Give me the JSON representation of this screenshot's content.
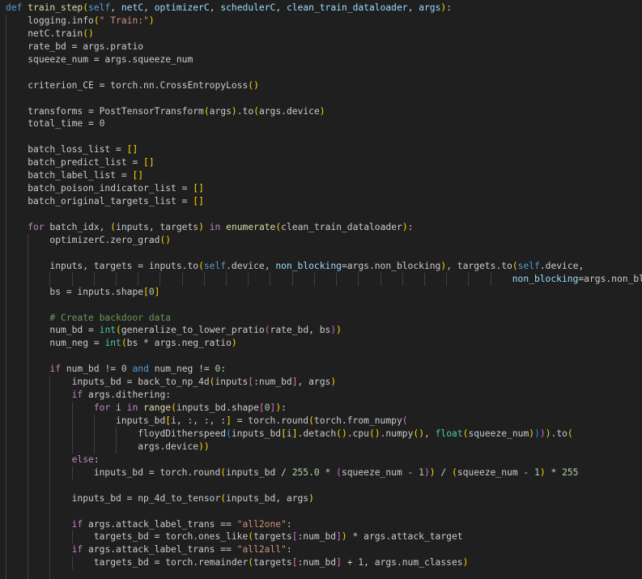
{
  "editor": {
    "language": "python",
    "colors": {
      "background": "#1f1f1f",
      "plain": "#cccccc",
      "keyword": "#569cd6",
      "control": "#c586c0",
      "function": "#dcdcaa",
      "string": "#ce9178",
      "number": "#b5cea8",
      "comment": "#6a9955",
      "class": "#4ec9b0",
      "bracket_1": "#ffd700",
      "bracket_2": "#da70d6",
      "bracket_3": "#179fff",
      "parameter": "#9cdcfe",
      "indent_guide": "#404040"
    },
    "lines": [
      {
        "indent": 0,
        "tokens": [
          [
            "kw",
            "def"
          ],
          [
            "pl",
            " "
          ],
          [
            "fn",
            "train_step"
          ],
          [
            "p1",
            "("
          ],
          [
            "self",
            "self"
          ],
          [
            "pl",
            ", "
          ],
          [
            "param",
            "netC"
          ],
          [
            "pl",
            ", "
          ],
          [
            "param",
            "optimizerC"
          ],
          [
            "pl",
            ", "
          ],
          [
            "param",
            "schedulerC"
          ],
          [
            "pl",
            ", "
          ],
          [
            "param",
            "clean_train_dataloader"
          ],
          [
            "pl",
            ", "
          ],
          [
            "param",
            "args"
          ],
          [
            "p1",
            ")"
          ],
          [
            "pl",
            ":"
          ]
        ]
      },
      {
        "indent": 1,
        "tokens": [
          [
            "pl",
            "logging.info"
          ],
          [
            "p1",
            "("
          ],
          [
            "str",
            "\" Train:\""
          ],
          [
            "p1",
            ")"
          ]
        ]
      },
      {
        "indent": 1,
        "tokens": [
          [
            "pl",
            "netC.train"
          ],
          [
            "p1",
            "()"
          ]
        ]
      },
      {
        "indent": 1,
        "tokens": [
          [
            "pl",
            "rate_bd = args.pratio"
          ]
        ]
      },
      {
        "indent": 1,
        "tokens": [
          [
            "pl",
            "squeeze_num = args.squeeze_num"
          ]
        ]
      },
      {
        "indent": 1,
        "tokens": []
      },
      {
        "indent": 1,
        "tokens": [
          [
            "pl",
            "criterion_CE = torch.nn.CrossEntropyLoss"
          ],
          [
            "p1",
            "()"
          ]
        ]
      },
      {
        "indent": 1,
        "tokens": []
      },
      {
        "indent": 1,
        "tokens": [
          [
            "pl",
            "transforms = PostTensorTransform"
          ],
          [
            "p1",
            "("
          ],
          [
            "pl",
            "args"
          ],
          [
            "p1",
            ")"
          ],
          [
            "pl",
            ".to"
          ],
          [
            "p1",
            "("
          ],
          [
            "pl",
            "args.device"
          ],
          [
            "p1",
            ")"
          ]
        ]
      },
      {
        "indent": 1,
        "tokens": [
          [
            "pl",
            "total_time = "
          ],
          [
            "num",
            "0"
          ]
        ]
      },
      {
        "indent": 1,
        "tokens": []
      },
      {
        "indent": 1,
        "tokens": [
          [
            "pl",
            "batch_loss_list = "
          ],
          [
            "p1",
            "[]"
          ]
        ]
      },
      {
        "indent": 1,
        "tokens": [
          [
            "pl",
            "batch_predict_list = "
          ],
          [
            "p1",
            "[]"
          ]
        ]
      },
      {
        "indent": 1,
        "tokens": [
          [
            "pl",
            "batch_label_list = "
          ],
          [
            "p1",
            "[]"
          ]
        ]
      },
      {
        "indent": 1,
        "tokens": [
          [
            "pl",
            "batch_poison_indicator_list = "
          ],
          [
            "p1",
            "[]"
          ]
        ]
      },
      {
        "indent": 1,
        "tokens": [
          [
            "pl",
            "batch_original_targets_list = "
          ],
          [
            "p1",
            "[]"
          ]
        ]
      },
      {
        "indent": 1,
        "tokens": []
      },
      {
        "indent": 1,
        "tokens": [
          [
            "ctl",
            "for"
          ],
          [
            "pl",
            " batch_idx, "
          ],
          [
            "p1",
            "("
          ],
          [
            "pl",
            "inputs, targets"
          ],
          [
            "p1",
            ")"
          ],
          [
            "pl",
            " "
          ],
          [
            "ctl",
            "in"
          ],
          [
            "pl",
            " "
          ],
          [
            "fn",
            "enumerate"
          ],
          [
            "p1",
            "("
          ],
          [
            "pl",
            "clean_train_dataloader"
          ],
          [
            "p1",
            ")"
          ],
          [
            "pl",
            ":"
          ]
        ]
      },
      {
        "indent": 2,
        "tokens": [
          [
            "pl",
            "optimizerC.zero_grad"
          ],
          [
            "p1",
            "()"
          ]
        ]
      },
      {
        "indent": 2,
        "tokens": []
      },
      {
        "indent": 2,
        "tokens": [
          [
            "pl",
            "inputs, targets = inputs.to"
          ],
          [
            "p1",
            "("
          ],
          [
            "self",
            "self"
          ],
          [
            "pl",
            ".device, "
          ],
          [
            "param",
            "non_blocking"
          ],
          [
            "pl",
            "=args.non_blocking"
          ],
          [
            "p1",
            ")"
          ],
          [
            "pl",
            ", targets.to"
          ],
          [
            "p1",
            "("
          ],
          [
            "self",
            "self"
          ],
          [
            "pl",
            ".device,"
          ]
        ]
      },
      {
        "indent": 23,
        "tokens": [
          [
            "param",
            "non_blocking"
          ],
          [
            "pl",
            "=args.non_blocking"
          ],
          [
            "p1",
            ")"
          ]
        ]
      },
      {
        "indent": 2,
        "tokens": [
          [
            "pl",
            "bs = inputs.shape"
          ],
          [
            "p1",
            "["
          ],
          [
            "num",
            "0"
          ],
          [
            "p1",
            "]"
          ]
        ]
      },
      {
        "indent": 2,
        "tokens": []
      },
      {
        "indent": 2,
        "tokens": [
          [
            "cmt",
            "# Create backdoor data"
          ]
        ]
      },
      {
        "indent": 2,
        "tokens": [
          [
            "pl",
            "num_bd = "
          ],
          [
            "cls",
            "int"
          ],
          [
            "p1",
            "("
          ],
          [
            "pl",
            "generalize_to_lower_pratio"
          ],
          [
            "p2",
            "("
          ],
          [
            "pl",
            "rate_bd, bs"
          ],
          [
            "p2",
            ")"
          ],
          [
            "p1",
            ")"
          ]
        ]
      },
      {
        "indent": 2,
        "tokens": [
          [
            "pl",
            "num_neg = "
          ],
          [
            "cls",
            "int"
          ],
          [
            "p1",
            "("
          ],
          [
            "pl",
            "bs * args.neg_ratio"
          ],
          [
            "p1",
            ")"
          ]
        ]
      },
      {
        "indent": 2,
        "tokens": []
      },
      {
        "indent": 2,
        "tokens": [
          [
            "ctl",
            "if"
          ],
          [
            "pl",
            " num_bd != "
          ],
          [
            "num",
            "0"
          ],
          [
            "pl",
            " "
          ],
          [
            "kw",
            "and"
          ],
          [
            "pl",
            " num_neg != "
          ],
          [
            "num",
            "0"
          ],
          [
            "pl",
            ":"
          ]
        ]
      },
      {
        "indent": 3,
        "tokens": [
          [
            "pl",
            "inputs_bd = back_to_np_4d"
          ],
          [
            "p1",
            "("
          ],
          [
            "pl",
            "inputs"
          ],
          [
            "p2",
            "["
          ],
          [
            "pl",
            ":num_bd"
          ],
          [
            "p2",
            "]"
          ],
          [
            "pl",
            ", args"
          ],
          [
            "p1",
            ")"
          ]
        ]
      },
      {
        "indent": 3,
        "tokens": [
          [
            "ctl",
            "if"
          ],
          [
            "pl",
            " args.dithering:"
          ]
        ]
      },
      {
        "indent": 4,
        "tokens": [
          [
            "ctl",
            "for"
          ],
          [
            "pl",
            " i "
          ],
          [
            "ctl",
            "in"
          ],
          [
            "pl",
            " "
          ],
          [
            "fn",
            "range"
          ],
          [
            "p1",
            "("
          ],
          [
            "pl",
            "inputs_bd.shape"
          ],
          [
            "p2",
            "["
          ],
          [
            "num",
            "0"
          ],
          [
            "p2",
            "]"
          ],
          [
            "p1",
            ")"
          ],
          [
            "pl",
            ":"
          ]
        ]
      },
      {
        "indent": 5,
        "tokens": [
          [
            "pl",
            "inputs_bd"
          ],
          [
            "p1",
            "["
          ],
          [
            "pl",
            "i, :, :, :"
          ],
          [
            "p1",
            "]"
          ],
          [
            "pl",
            " = torch.round"
          ],
          [
            "p1",
            "("
          ],
          [
            "pl",
            "torch.from_numpy"
          ],
          [
            "p2",
            "("
          ]
        ]
      },
      {
        "indent": 6,
        "tokens": [
          [
            "pl",
            "floydDitherspeed"
          ],
          [
            "p3",
            "("
          ],
          [
            "pl",
            "inputs_bd"
          ],
          [
            "p1",
            "["
          ],
          [
            "pl",
            "i"
          ],
          [
            "p1",
            "]"
          ],
          [
            "pl",
            ".detach"
          ],
          [
            "p1",
            "()"
          ],
          [
            "pl",
            ".cpu"
          ],
          [
            "p1",
            "()"
          ],
          [
            "pl",
            ".numpy"
          ],
          [
            "p1",
            "()"
          ],
          [
            "pl",
            ", "
          ],
          [
            "cls",
            "float"
          ],
          [
            "p1",
            "("
          ],
          [
            "pl",
            "squeeze_num"
          ],
          [
            "p1",
            ")"
          ],
          [
            "p3",
            ")"
          ],
          [
            "p2",
            ")"
          ],
          [
            "p1",
            ")"
          ],
          [
            "pl",
            ".to"
          ],
          [
            "p1",
            "("
          ]
        ]
      },
      {
        "indent": 6,
        "tokens": [
          [
            "pl",
            "args.device"
          ],
          [
            "p1",
            "))"
          ]
        ]
      },
      {
        "indent": 3,
        "tokens": [
          [
            "ctl",
            "else"
          ],
          [
            "pl",
            ":"
          ]
        ]
      },
      {
        "indent": 4,
        "tokens": [
          [
            "pl",
            "inputs_bd = torch.round"
          ],
          [
            "p1",
            "("
          ],
          [
            "pl",
            "inputs_bd / "
          ],
          [
            "num",
            "255.0"
          ],
          [
            "pl",
            " * "
          ],
          [
            "p2",
            "("
          ],
          [
            "pl",
            "squeeze_num - "
          ],
          [
            "num",
            "1"
          ],
          [
            "p2",
            ")"
          ],
          [
            "p1",
            ")"
          ],
          [
            "pl",
            " / "
          ],
          [
            "p1",
            "("
          ],
          [
            "pl",
            "squeeze_num - "
          ],
          [
            "num",
            "1"
          ],
          [
            "p1",
            ")"
          ],
          [
            "pl",
            " * "
          ],
          [
            "num",
            "255"
          ]
        ]
      },
      {
        "indent": 3,
        "tokens": []
      },
      {
        "indent": 3,
        "tokens": [
          [
            "pl",
            "inputs_bd = np_4d_to_tensor"
          ],
          [
            "p1",
            "("
          ],
          [
            "pl",
            "inputs_bd, args"
          ],
          [
            "p1",
            ")"
          ]
        ]
      },
      {
        "indent": 3,
        "tokens": []
      },
      {
        "indent": 3,
        "tokens": [
          [
            "ctl",
            "if"
          ],
          [
            "pl",
            " args.attack_label_trans == "
          ],
          [
            "str",
            "\"all2one\""
          ],
          [
            "pl",
            ":"
          ]
        ]
      },
      {
        "indent": 4,
        "tokens": [
          [
            "pl",
            "targets_bd = torch.ones_like"
          ],
          [
            "p1",
            "("
          ],
          [
            "pl",
            "targets"
          ],
          [
            "p2",
            "["
          ],
          [
            "pl",
            ":num_bd"
          ],
          [
            "p2",
            "]"
          ],
          [
            "p1",
            ")"
          ],
          [
            "pl",
            " * args.attack_target"
          ]
        ]
      },
      {
        "indent": 3,
        "tokens": [
          [
            "ctl",
            "if"
          ],
          [
            "pl",
            " args.attack_label_trans == "
          ],
          [
            "str",
            "\"all2all\""
          ],
          [
            "pl",
            ":"
          ]
        ]
      },
      {
        "indent": 4,
        "tokens": [
          [
            "pl",
            "targets_bd = torch.remainder"
          ],
          [
            "p1",
            "("
          ],
          [
            "pl",
            "targets"
          ],
          [
            "p2",
            "["
          ],
          [
            "pl",
            ":num_bd"
          ],
          [
            "p2",
            "]"
          ],
          [
            "pl",
            " + "
          ],
          [
            "num",
            "1"
          ],
          [
            "pl",
            ", args.num_classes"
          ],
          [
            "p1",
            ")"
          ]
        ]
      },
      {
        "indent": 3,
        "tokens": []
      }
    ]
  }
}
